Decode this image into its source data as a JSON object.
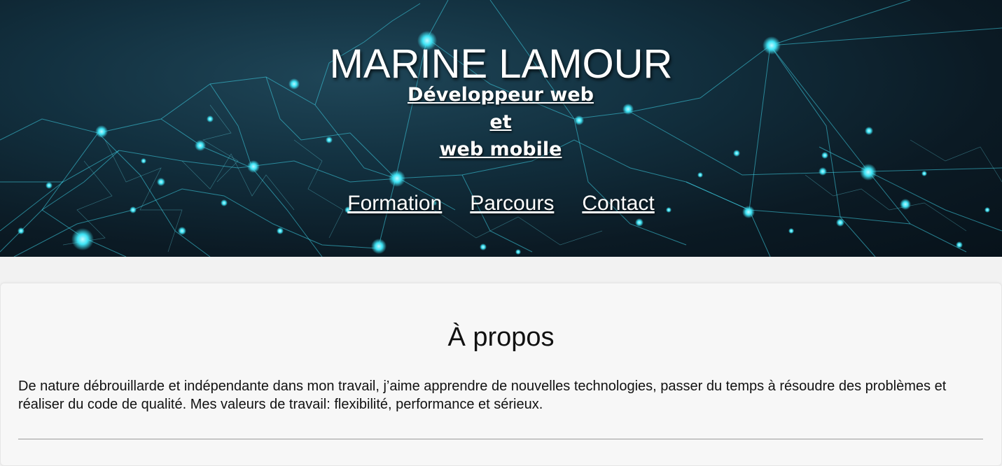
{
  "header": {
    "title": "MARINE LAMOUR",
    "subtitle_line1": "Développeur web et",
    "subtitle_line2": "web mobile"
  },
  "nav": [
    {
      "label": "Formation"
    },
    {
      "label": "Parcours"
    },
    {
      "label": "Contact"
    }
  ],
  "about": {
    "heading": "À propos",
    "text": "De nature débrouillarde et indépendante dans mon travail, j’aime apprendre de nouvelles technologies, passer du temps à résoudre des problèmes et réaliser du code de qualité. Mes valeurs de travail: flexibilité, performance et sérieux."
  },
  "colors": {
    "accent": "#3fe4f5",
    "hero_dark": "#0b1a24",
    "page_bg": "#f7f7f7"
  }
}
